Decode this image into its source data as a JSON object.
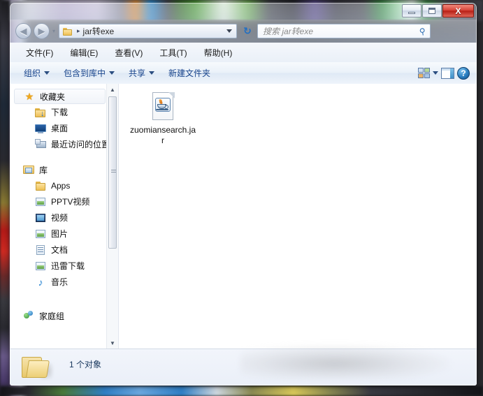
{
  "window": {
    "title": "jar转exe",
    "caption_buttons": [
      {
        "name": "minimize",
        "glyph": "–"
      },
      {
        "name": "maximize",
        "glyph": "□"
      },
      {
        "name": "close",
        "glyph": "X"
      }
    ]
  },
  "address_bar": {
    "back_glyph": "◀",
    "forward_glyph": "▶",
    "history_glyph": "▾",
    "breadcrumb_separator": "▸",
    "breadcrumb_path": "jar转exe",
    "refresh_glyph": "↻",
    "dropdown_glyph": "▾"
  },
  "search": {
    "placeholder": "搜索 jar转exe",
    "icon_glyph": "⚲"
  },
  "menu": {
    "items": [
      {
        "label": "文件(F)"
      },
      {
        "label": "编辑(E)"
      },
      {
        "label": "查看(V)"
      },
      {
        "label": "工具(T)"
      },
      {
        "label": "帮助(H)"
      }
    ]
  },
  "toolbar": {
    "items": [
      {
        "label": "组织",
        "has_caret": true
      },
      {
        "label": "包含到库中",
        "has_caret": true
      },
      {
        "label": "共享",
        "has_caret": true
      },
      {
        "label": "新建文件夹",
        "has_caret": false
      }
    ],
    "view_caret_glyph": "▾",
    "help_glyph": "?"
  },
  "navigation_pane": {
    "groups": [
      {
        "header": "收藏夹",
        "icon": "star-icon",
        "highlighted": true,
        "items": [
          {
            "label": "下载",
            "icon": "folder-download-icon"
          },
          {
            "label": "桌面",
            "icon": "desktop-icon"
          },
          {
            "label": "最近访问的位置",
            "icon": "recent-places-icon"
          }
        ]
      },
      {
        "header": "库",
        "icon": "libraries-icon",
        "highlighted": false,
        "items": [
          {
            "label": "Apps",
            "icon": "folder-icon"
          },
          {
            "label": "PPTV视频",
            "icon": "pptv-icon"
          },
          {
            "label": "视频",
            "icon": "video-icon"
          },
          {
            "label": "图片",
            "icon": "pictures-icon"
          },
          {
            "label": "文档",
            "icon": "documents-icon"
          },
          {
            "label": "迅雷下载",
            "icon": "thunder-download-icon"
          },
          {
            "label": "音乐",
            "icon": "music-icon"
          }
        ]
      },
      {
        "header": "家庭组",
        "icon": "homegroup-icon",
        "highlighted": false,
        "items": []
      }
    ],
    "scrollbar": {
      "up_glyph": "▲",
      "down_glyph": "▼"
    }
  },
  "files": [
    {
      "name": "zuomiansearch.jar",
      "icon": "java-jar-icon"
    }
  ],
  "status_bar": {
    "item_count_text": "1 个对象",
    "folder_icon": "open-folder-icon"
  },
  "colors": {
    "accent_blue": "#15428b",
    "close_red": "#b82016",
    "status_text": "#17365d",
    "folder_yellow": "#eec055"
  }
}
